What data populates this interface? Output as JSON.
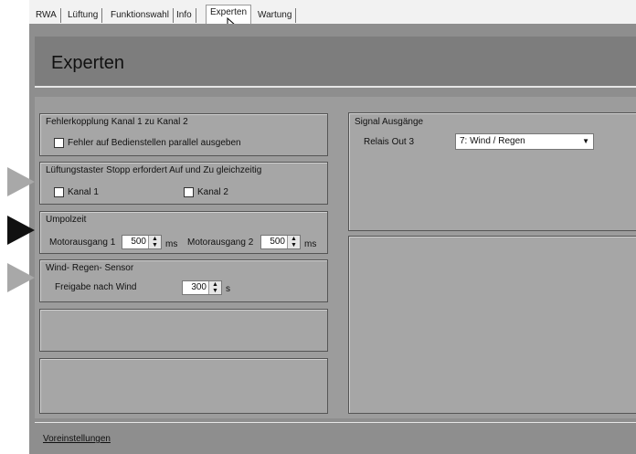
{
  "tabs": [
    {
      "label": "RWA"
    },
    {
      "label": "Lüftung"
    },
    {
      "label": "Funktionswahl"
    },
    {
      "label": "Info"
    },
    {
      "label": "Experten"
    },
    {
      "label": "Wartung"
    }
  ],
  "active_tab": "Experten",
  "header": {
    "title": "Experten"
  },
  "groups": {
    "fehlerkopplung": {
      "title": "Fehlerkopplung Kanal 1 zu Kanal 2",
      "checkbox_label": "Fehler auf Bedienstellen parallel ausgeben",
      "checked": false
    },
    "lueftungstaster": {
      "title": "Lüftungstaster Stopp erfordert Auf und Zu gleichzeitig",
      "kanal1_label": "Kanal 1",
      "kanal2_label": "Kanal 2",
      "kanal1_checked": false,
      "kanal2_checked": false
    },
    "umpolzeit": {
      "title": "Umpolzeit",
      "motor1_label": "Motorausgang 1",
      "motor1_value": "500",
      "motor1_unit": "ms",
      "motor2_label": "Motorausgang 2",
      "motor2_value": "500",
      "motor2_unit": "ms"
    },
    "wind": {
      "title": "Wind- Regen- Sensor",
      "freigabe_label": "Freigabe nach Wind",
      "freigabe_value": "300",
      "freigabe_unit": "s"
    },
    "signal": {
      "title": "Signal Ausgänge",
      "relais_label": "Relais Out 3",
      "relais_value": "7: Wind / Regen"
    }
  },
  "spin_up": "▲",
  "spin_down": "▼",
  "dropdown_arrow": "▼",
  "footer": {
    "link": "Voreinstellungen"
  },
  "colors": {
    "marker_gray": "#a8a8a8",
    "marker_black": "#111111"
  },
  "icons": [
    "mouse-cursor-icon",
    "chevron-down-icon",
    "spin-up-icon",
    "spin-down-icon"
  ]
}
